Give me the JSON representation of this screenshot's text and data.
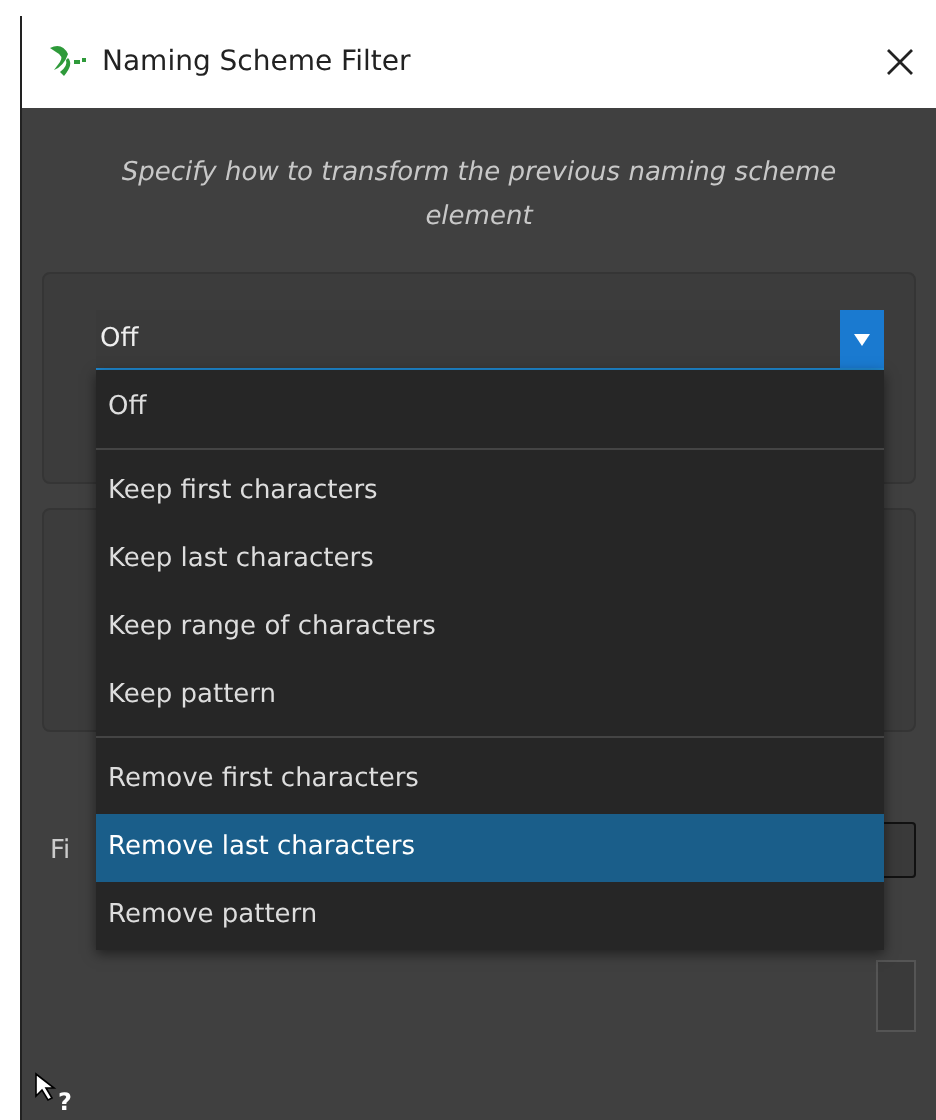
{
  "window": {
    "title": "Naming Scheme Filter"
  },
  "description": "Specify how to transform the previous naming scheme element",
  "combo": {
    "value": "Off",
    "expanded": true
  },
  "dropdown": [
    {
      "kind": "item",
      "label": "Off",
      "selected": false
    },
    {
      "kind": "separator"
    },
    {
      "kind": "item",
      "label": "Keep first characters",
      "selected": false
    },
    {
      "kind": "item",
      "label": "Keep last characters",
      "selected": false
    },
    {
      "kind": "item",
      "label": "Keep range of characters",
      "selected": false
    },
    {
      "kind": "item",
      "label": "Keep pattern",
      "selected": false
    },
    {
      "kind": "separator"
    },
    {
      "kind": "item",
      "label": "Remove first characters",
      "selected": false
    },
    {
      "kind": "item",
      "label": "Remove last characters",
      "selected": true
    },
    {
      "kind": "item",
      "label": "Remove pattern",
      "selected": false
    }
  ],
  "background_label": "Fi",
  "help_mark": "?"
}
